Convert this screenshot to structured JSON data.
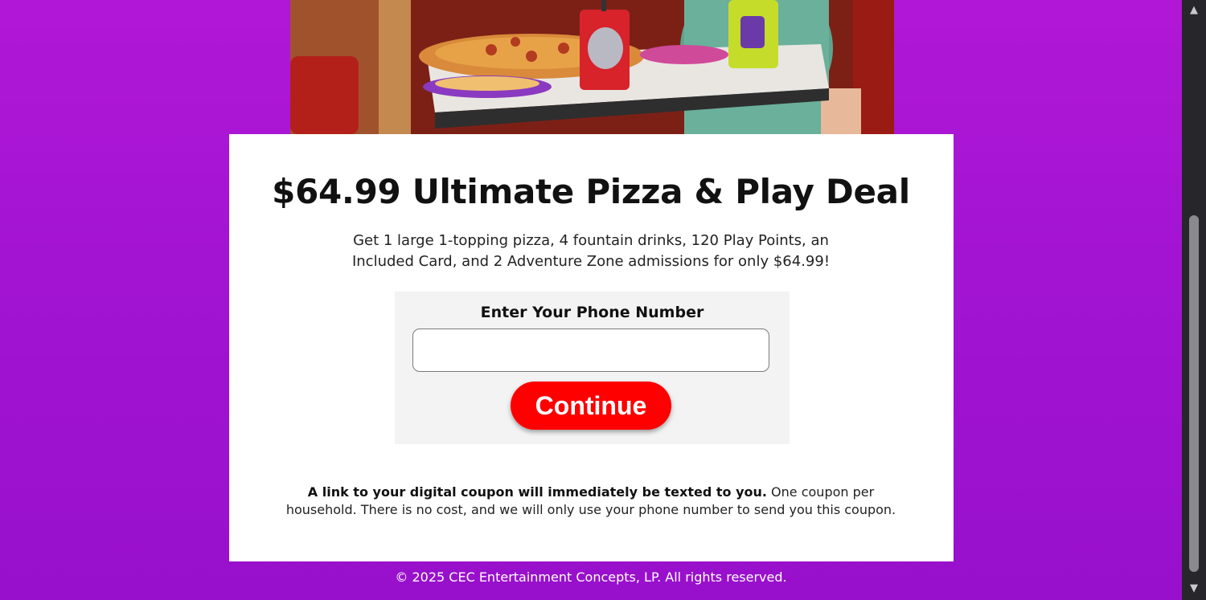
{
  "hero": {
    "image_name": "family-pizza-table-photo"
  },
  "offer": {
    "title": "$64.99 Ultimate Pizza & Play Deal",
    "description": "Get 1 large 1-topping pizza, 4 fountain drinks, 120 Play Points, an Included Card, and 2 Adventure Zone admissions for only $64.99!"
  },
  "form": {
    "phone_label": "Enter Your Phone Number",
    "phone_value": "",
    "phone_placeholder": "",
    "continue_label": "Continue"
  },
  "disclaimer": {
    "bold": "A link to your digital coupon will immediately be texted to you.",
    "rest": " One coupon per household. There is no cost, and we will only use your phone number to send you this coupon."
  },
  "footer": {
    "copyright": "© 2025 CEC Entertainment Concepts, LP. All rights reserved."
  },
  "scrollbar": {
    "up_icon": "▲",
    "down_icon": "▼"
  },
  "colors": {
    "background_top": "#b117d6",
    "background_bottom": "#9810cc",
    "button": "#ff0000",
    "card": "#ffffff"
  }
}
